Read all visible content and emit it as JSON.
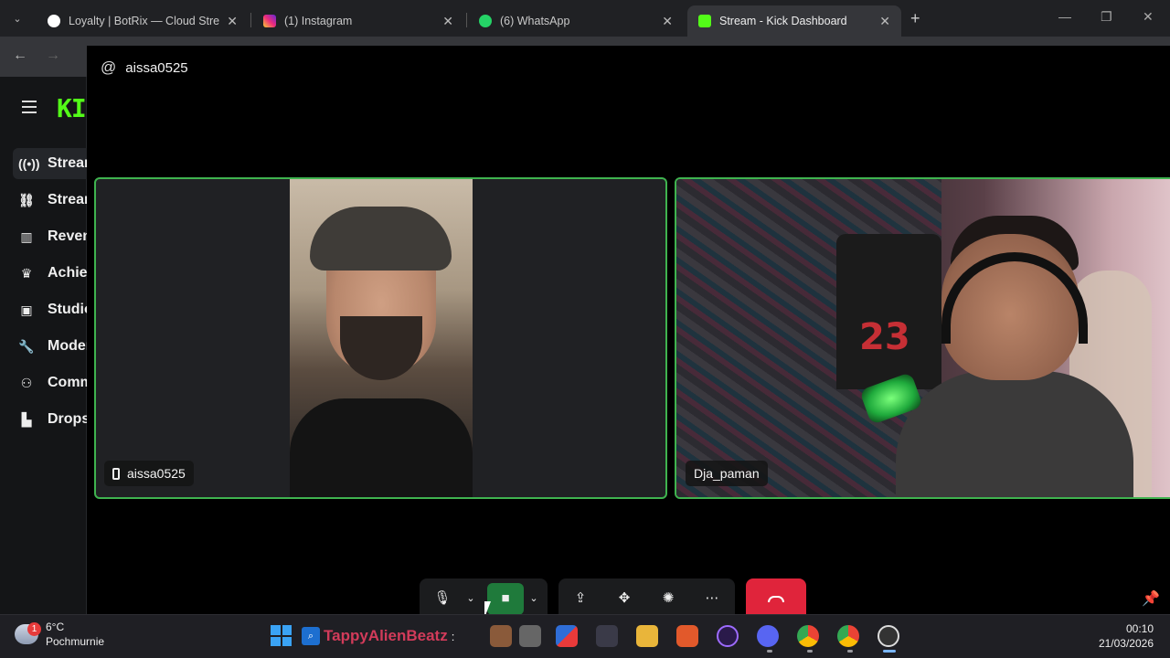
{
  "browser": {
    "tabs": [
      {
        "title": "Loyalty | BotRix — Cloud Stream",
        "favicon": "botrix-icon",
        "color": "#ffffff"
      },
      {
        "title": "(1) Instagram",
        "favicon": "instagram-icon",
        "color": "#d62976"
      },
      {
        "title": "(6) WhatsApp",
        "favicon": "whatsapp-icon",
        "color": "#25d366"
      },
      {
        "title": "Stream - Kick Dashboard",
        "favicon": "kick-icon",
        "color": "#53fc18",
        "active": true
      }
    ],
    "new_tab": "+",
    "close_glyph": "✕"
  },
  "kick": {
    "logo": "KI",
    "sidebar": [
      {
        "label": "Stream",
        "icon": "broadcast-icon",
        "active": true
      },
      {
        "label": "Stream",
        "icon": "link-icon"
      },
      {
        "label": "Revenue",
        "icon": "chart-icon"
      },
      {
        "label": "Achievements",
        "icon": "trophy-icon"
      },
      {
        "label": "Studio",
        "icon": "film-icon"
      },
      {
        "label": "Moderation",
        "icon": "wrench-icon"
      },
      {
        "label": "Community",
        "icon": "people-icon"
      },
      {
        "label": "Drops",
        "icon": "drops-icon"
      }
    ]
  },
  "call": {
    "caller": "aissa0525",
    "participants": [
      {
        "name": "aissa0525",
        "device": "phone-icon"
      },
      {
        "name": "Dja_paman"
      }
    ],
    "controls": {
      "hangup": "end-call-icon"
    }
  },
  "taskbar": {
    "weather": {
      "temp": "6°C",
      "desc": "Pochmurnie",
      "badge": "1"
    },
    "search_text": "TappyAlienBeatz",
    "search_sep": ":",
    "time": "00:10",
    "date": "21/03/2026"
  },
  "colors": {
    "accent": "#53fc18",
    "tile_border": "#3fb34f",
    "hangup": "#e0243b",
    "camera_active": "#1f7a3b"
  }
}
